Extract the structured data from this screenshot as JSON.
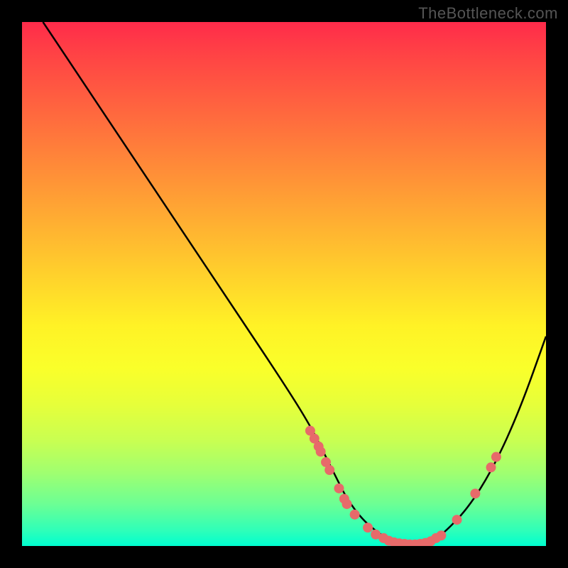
{
  "watermark": "TheBottleneck.com",
  "chart_data": {
    "type": "line",
    "title": "",
    "xlabel": "",
    "ylabel": "",
    "xlim": [
      0,
      100
    ],
    "ylim": [
      0,
      100
    ],
    "series": [
      {
        "name": "curve",
        "x": [
          4,
          10,
          20,
          30,
          40,
          50,
          55,
          58,
          60,
          62,
          65,
          68,
          70,
          72,
          75,
          78,
          80,
          85,
          90,
          95,
          100
        ],
        "y": [
          100,
          91,
          76,
          61,
          46,
          31,
          23,
          17,
          13,
          9,
          5,
          2.5,
          1.2,
          0.5,
          0.3,
          0.8,
          2,
          7,
          15,
          26,
          40
        ]
      }
    ],
    "markers": [
      {
        "x": 55.0,
        "y": 22.0
      },
      {
        "x": 55.8,
        "y": 20.5
      },
      {
        "x": 56.6,
        "y": 19.0
      },
      {
        "x": 57.0,
        "y": 18.0
      },
      {
        "x": 58.0,
        "y": 16.0
      },
      {
        "x": 58.7,
        "y": 14.5
      },
      {
        "x": 60.5,
        "y": 11.0
      },
      {
        "x": 61.5,
        "y": 9.0
      },
      {
        "x": 62.0,
        "y": 8.0
      },
      {
        "x": 63.5,
        "y": 6.0
      },
      {
        "x": 66.0,
        "y": 3.5
      },
      {
        "x": 67.5,
        "y": 2.2
      },
      {
        "x": 69.0,
        "y": 1.5
      },
      {
        "x": 70.0,
        "y": 1.0
      },
      {
        "x": 71.0,
        "y": 0.7
      },
      {
        "x": 72.0,
        "y": 0.5
      },
      {
        "x": 73.0,
        "y": 0.4
      },
      {
        "x": 74.0,
        "y": 0.3
      },
      {
        "x": 75.0,
        "y": 0.3
      },
      {
        "x": 76.0,
        "y": 0.4
      },
      {
        "x": 77.0,
        "y": 0.6
      },
      {
        "x": 78.0,
        "y": 0.9
      },
      {
        "x": 79.0,
        "y": 1.5
      },
      {
        "x": 80.0,
        "y": 2.0
      },
      {
        "x": 83.0,
        "y": 5.0
      },
      {
        "x": 86.5,
        "y": 10.0
      },
      {
        "x": 89.5,
        "y": 15.0
      },
      {
        "x": 90.5,
        "y": 17.0
      }
    ],
    "colors": {
      "curve": "#000000",
      "marker_fill": "#e76a6a",
      "marker_stroke": "#d85555"
    }
  }
}
